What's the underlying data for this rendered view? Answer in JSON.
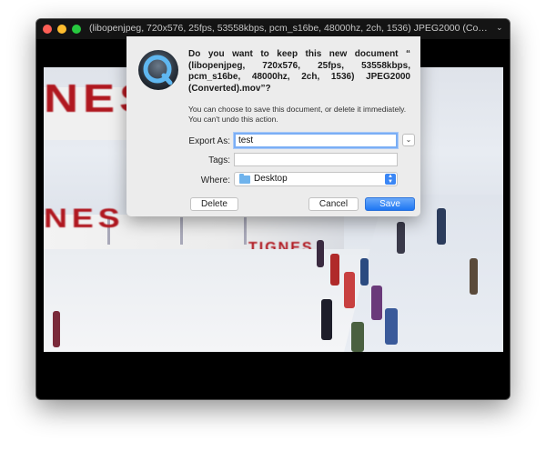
{
  "window": {
    "title": "(libopenjpeg, 720x576, 25fps, 53558kbps, pcm_s16be, 48000hz, 2ch, 1536) JPEG2000 (Conve...",
    "title_chevron": "⌄",
    "traffic_lights": {
      "close_color": "#ff5f56",
      "minimize_color": "#ffbd2e",
      "maximize_color": "#27c93f"
    }
  },
  "video_frame": {
    "banner_big_text": "NES",
    "banner_mid_text": "NES",
    "banner_small_text": "TIGNES"
  },
  "dialog": {
    "icon": "quicktime-icon",
    "title": "Do you want to keep this new document “ (libopenjpeg, 720x576, 25fps, 53558kbps, pcm_s16be, 48000hz, 2ch, 1536) JPEG2000 (Converted).mov”?",
    "body": "You can choose to save this document, or delete it immediately. You can't undo this action.",
    "export_as": {
      "label": "Export As:",
      "value": "test"
    },
    "tags": {
      "label": "Tags:",
      "value": ""
    },
    "where": {
      "label": "Where:",
      "value": "Desktop",
      "icon": "folder-icon"
    },
    "buttons": {
      "delete": "Delete",
      "cancel": "Cancel",
      "save": "Save"
    },
    "expand_glyph": "⌄",
    "accent_color": "#1e76f3"
  }
}
